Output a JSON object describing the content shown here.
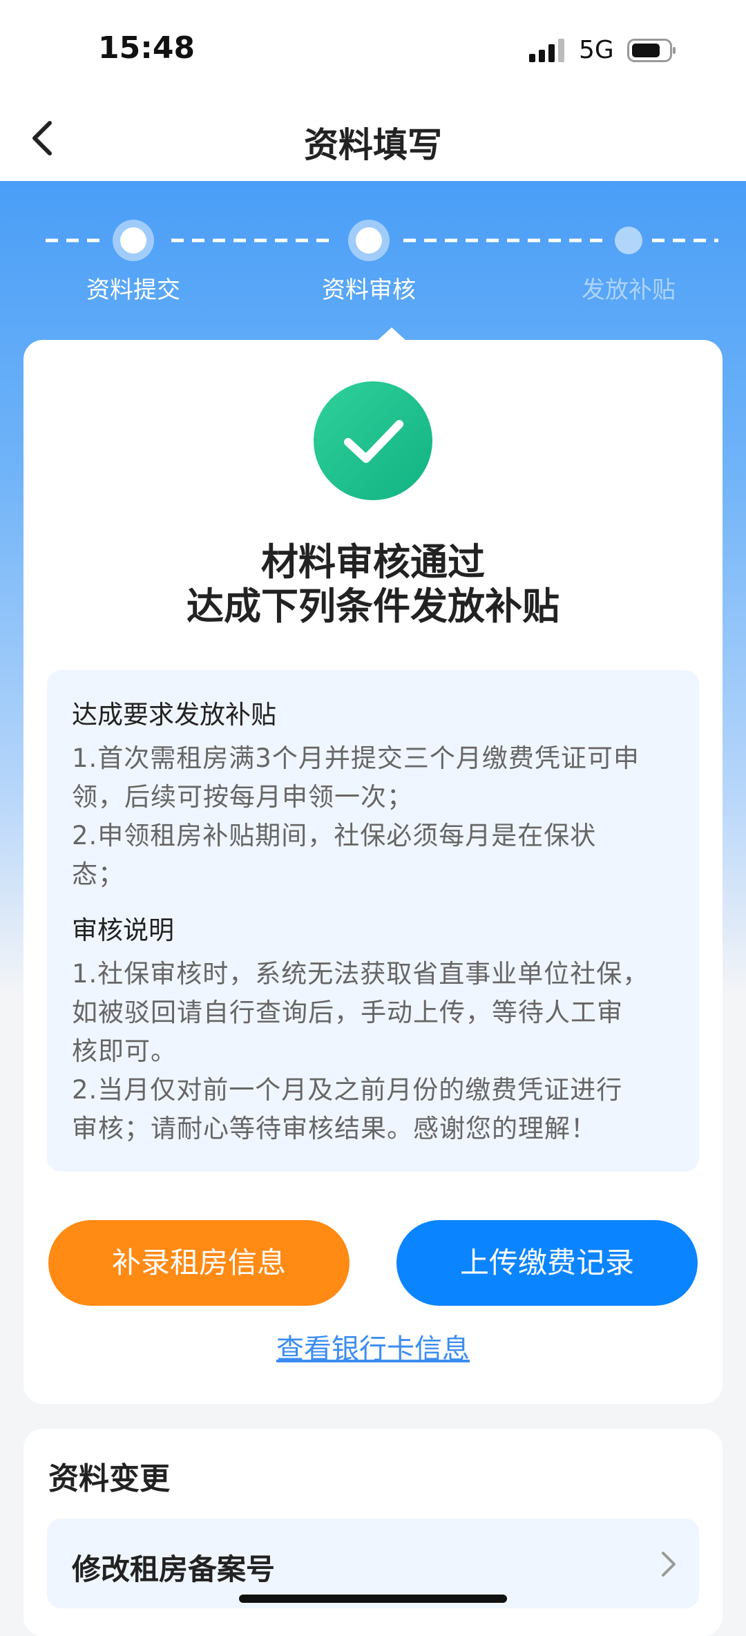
{
  "status_bar": {
    "time": "15:48",
    "network": "5G"
  },
  "nav": {
    "title": "资料填写"
  },
  "steps": [
    {
      "label": "资料提交",
      "state": "done"
    },
    {
      "label": "资料审核",
      "state": "current"
    },
    {
      "label": "发放补贴",
      "state": "pending"
    }
  ],
  "result": {
    "title_line1": "材料审核通过",
    "title_line2": "达成下列条件发放补贴"
  },
  "info": {
    "section1_heading": "达成要求发放补贴",
    "section1_line1": "1.首次需租房满3个月并提交三个月缴费凭证可申",
    "section1_line2": "领，后续可按每月申领一次；",
    "section1_line3": "2.申领租房补贴期间，社保必须每月是在保状",
    "section1_line4": "态；",
    "section2_heading": "审核说明",
    "section2_line1": "1.社保审核时，系统无法获取省直事业单位社保，",
    "section2_line2": "如被驳回请自行查询后，手动上传，等待人工审",
    "section2_line3": "核即可。",
    "section2_line4": "2.当月仅对前一个月及之前月份的缴费凭证进行",
    "section2_line5": "审核；请耐心等待审核结果。感谢您的理解！"
  },
  "actions": {
    "supplement_label": "补录租房信息",
    "upload_label": "上传缴费记录",
    "bank_link": "查看银行卡信息"
  },
  "change": {
    "title": "资料变更",
    "item_label": "修改租房备案号"
  },
  "colors": {
    "primary_blue": "#0b84ff",
    "orange": "#ff8a14",
    "success_green": "#1cc08f",
    "link_blue": "#3b8cf2"
  }
}
